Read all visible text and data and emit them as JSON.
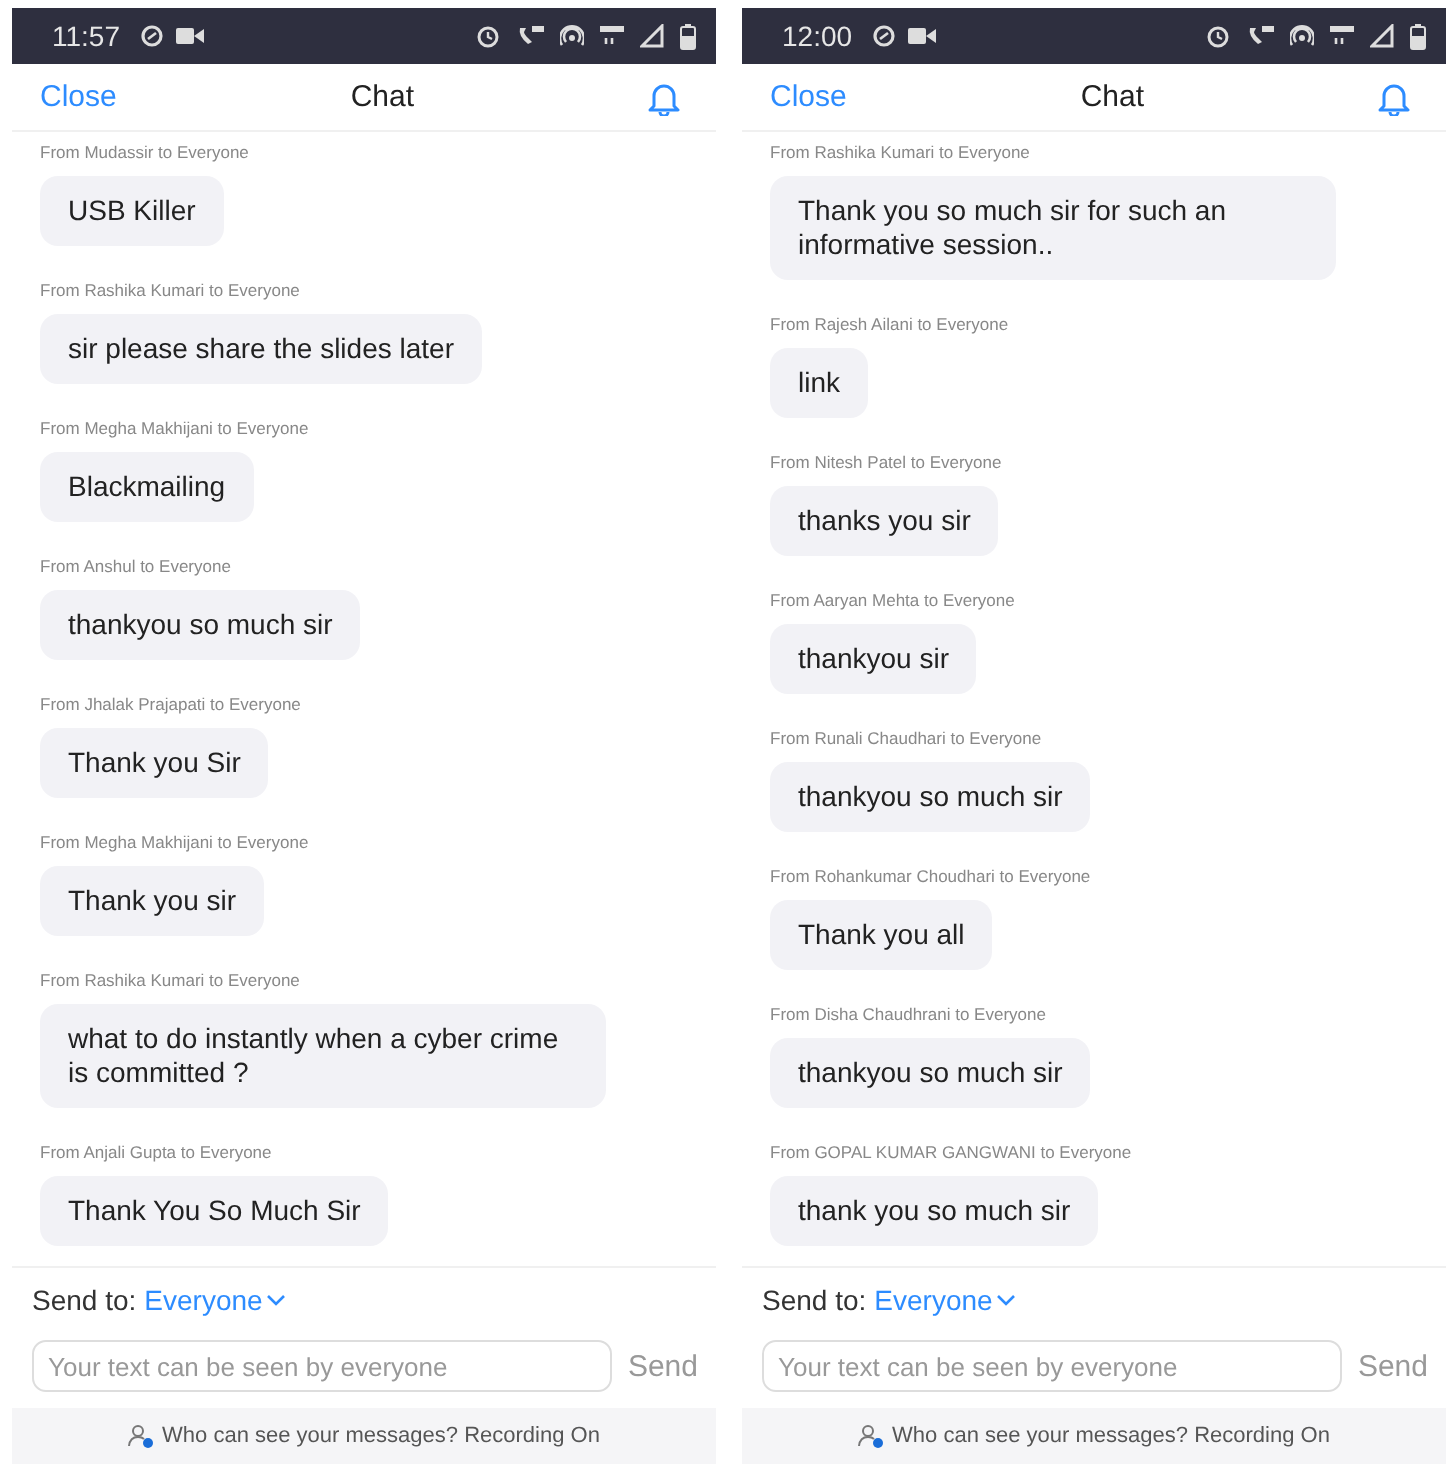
{
  "screens": [
    {
      "status_bar": {
        "time": "11:57"
      },
      "header": {
        "close": "Close",
        "title": "Chat"
      },
      "messages": [
        {
          "sender": "From Mudassir to Everyone",
          "text": "USB Killer"
        },
        {
          "sender": "From Rashika Kumari to Everyone",
          "text": "sir please share the slides later"
        },
        {
          "sender": "From Megha Makhijani to Everyone",
          "text": "Blackmailing"
        },
        {
          "sender": "From Anshul to Everyone",
          "text": "thankyou so much sir"
        },
        {
          "sender": "From Jhalak Prajapati to Everyone",
          "text": "Thank you Sir"
        },
        {
          "sender": "From Megha Makhijani to Everyone",
          "text": "Thank you sir"
        },
        {
          "sender": "From Rashika Kumari to Everyone",
          "text": "what to do instantly when a cyber crime is committed ?"
        },
        {
          "sender": "From Anjali Gupta to Everyone",
          "text": "Thank You So Much Sir"
        }
      ],
      "send_to": {
        "label": "Send to:",
        "recipient": "Everyone"
      },
      "input": {
        "placeholder": "Your text can be seen by everyone"
      },
      "send_button": "Send",
      "footer": "Who can see your messages? Recording On"
    },
    {
      "status_bar": {
        "time": "12:00"
      },
      "header": {
        "close": "Close",
        "title": "Chat"
      },
      "messages": [
        {
          "sender": "From Rashika Kumari to Everyone",
          "text": "Thank you so much sir for such an informative session.."
        },
        {
          "sender": "From Rajesh Ailani to Everyone",
          "text": "link"
        },
        {
          "sender": "From Nitesh Patel to Everyone",
          "text": "thanks you sir"
        },
        {
          "sender": "From Aaryan Mehta to Everyone",
          "text": "thankyou sir"
        },
        {
          "sender": "From Runali Chaudhari to Everyone",
          "text": "thankyou so much sir"
        },
        {
          "sender": "From Rohankumar Choudhari to Everyone",
          "text": "Thank you all"
        },
        {
          "sender": "From Disha Chaudhrani to Everyone",
          "text": "thankyou so much sir"
        },
        {
          "sender": "From GOPAL KUMAR GANGWANI to Everyone",
          "text": "thank you so much sir"
        }
      ],
      "send_to": {
        "label": "Send to:",
        "recipient": "Everyone"
      },
      "input": {
        "placeholder": "Your text can be seen by everyone"
      },
      "send_button": "Send",
      "footer": "Who can see your messages? Recording On"
    }
  ]
}
